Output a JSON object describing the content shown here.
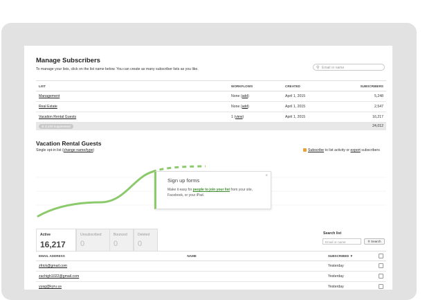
{
  "manage": {
    "title": "Manage Subscribers",
    "description": "To manage your lists, click on the list name below. You can create as many subscriber lists as you like.",
    "search_placeholder": "Email or name",
    "columns": {
      "list": "LIST",
      "workflows": "WORKFLOWS",
      "created": "CREATED",
      "subscribers": "SUBSCRIBERS"
    },
    "rows": [
      {
        "name": "Management",
        "workflows_prefix": "None (",
        "workflows_link": "add",
        "workflows_suffix": ")",
        "created": "April 1, 2015",
        "subscribers": "5,248"
      },
      {
        "name": "Real Estate",
        "workflows_prefix": "None (",
        "workflows_link": "add",
        "workflows_suffix": ")",
        "created": "April 1, 2015",
        "subscribers": "2,547"
      },
      {
        "name": "Vacation Rental Guests",
        "workflows_prefix": "1 (",
        "workflows_link": "view",
        "workflows_suffix": ")",
        "created": "April 1, 2015",
        "subscribers": "16,217"
      }
    ],
    "footer_badge": "4,240 suppressed",
    "footer_total": "24,012"
  },
  "list": {
    "title": "Vacation Rental Guests",
    "subtitle_prefix": "Single opt-in list (",
    "subtitle_link": "change name/type",
    "subtitle_suffix": ")",
    "subscribe_link": "Subscribe",
    "subscribe_mid": " to list activity or ",
    "export_link": "export",
    "export_suffix": " subscribers"
  },
  "popup": {
    "title": "Sign up forms",
    "body_prefix": "Make it easy for ",
    "body_link": "people to join your list",
    "body_suffix": " from your site, Facebook, or your iPad.",
    "close": "×"
  },
  "tabs": [
    {
      "label": "Active",
      "count": "16,217"
    },
    {
      "label": "Unsubscribed",
      "count": "0"
    },
    {
      "label": "Bounced",
      "count": "0"
    },
    {
      "label": "Deleted",
      "count": "0"
    }
  ],
  "search_list": {
    "label": "Search list",
    "placeholder": "Email or name",
    "button": "Search"
  },
  "emails": {
    "columns": {
      "email": "EMAIL ADDRESS",
      "name": "NAME",
      "subscribed": "SUBSCRIBED ▼"
    },
    "rows": [
      {
        "email": "zfrick@gmail.com",
        "name": "",
        "subscribed": "Yesterday"
      },
      {
        "email": "zachigh1022@gmail.com",
        "name": "",
        "subscribed": "Yesterday"
      },
      {
        "email": "yyag@kyru.us",
        "name": "",
        "subscribed": "Yesterday"
      }
    ]
  },
  "colors": {
    "accent_green": "#8bc96b",
    "device_gray": "#e2e2e2"
  }
}
